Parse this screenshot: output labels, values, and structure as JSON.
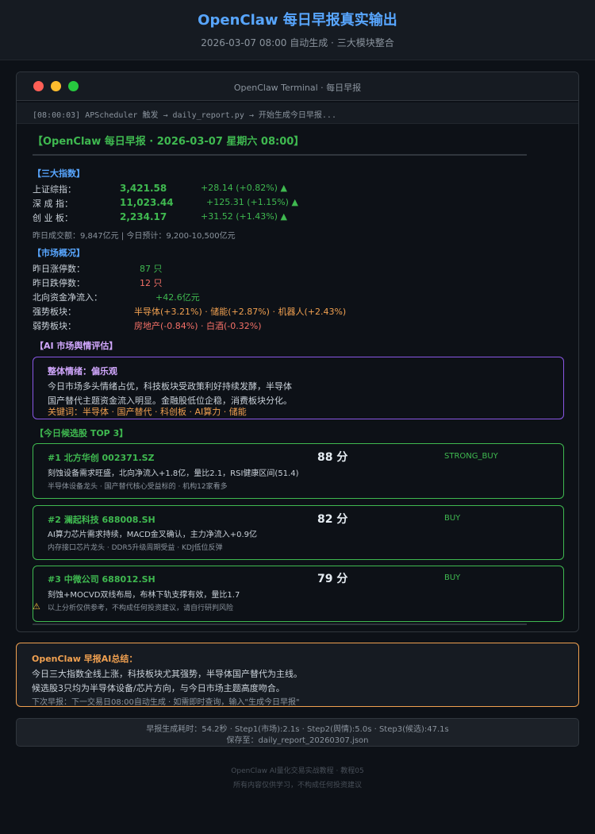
{
  "header": {
    "title": "OpenClaw 每日早报真实输出",
    "subtitle": "2026-03-07 08:00 自动生成 · 三大模块整合"
  },
  "terminal": {
    "window_title": "OpenClaw Terminal · 每日早报",
    "command_line": "[08:00:03] APScheduler 触发 → daily_report.py → 开始生成今日早报...",
    "report_title": "【OpenClaw 每日早报 · 2026-03-07 星期六 08:00】"
  },
  "indices": {
    "section_title": "【三大指数】",
    "rows": [
      {
        "label": "上证综指：",
        "value": "3,421.58",
        "change": "+28.14 (+0.82%) ▲"
      },
      {
        "label": "深 成 指：",
        "value": "11,023.44",
        "change": "+125.31 (+1.15%) ▲"
      },
      {
        "label": "创 业 板：",
        "value": "2,234.17",
        "change": "+31.52 (+1.43%) ▲"
      }
    ],
    "turnover": "昨日成交额：9,847亿元 | 今日预计：9,200-10,500亿元"
  },
  "market": {
    "section_title": "【市场概况】",
    "limit_up_label": "昨日涨停数：",
    "limit_up_value": "87 只",
    "limit_down_label": "昨日跌停数：",
    "limit_down_value": "12 只",
    "northbound_label": "北向资金净流入：",
    "northbound_value": "+42.6亿元",
    "strong_label": "强势板块：",
    "strong_value": "半导体(+3.21%) · 储能(+2.87%) · 机器人(+2.43%)",
    "weak_label": "弱势板块：",
    "weak_value": "房地产(-0.84%) · 白酒(-0.32%)"
  },
  "sentiment": {
    "section_title": "【AI 市场舆情评估】",
    "overall": "整体情绪：偏乐观",
    "line1": "今日市场多头情绪占优，科技板块受政策利好持续发酵，半导体",
    "line2": "国产替代主题资金流入明显。金融股低位企稳，消费板块分化。",
    "keywords": "关键词：半导体 · 国产替代 · 科创板 · AI算力 · 储能"
  },
  "picks": {
    "section_title": "【今日候选股 TOP 3】",
    "items": [
      {
        "head": "#1 北方华创 002371.SZ",
        "score": "88 分",
        "signal": "STRONG_BUY",
        "desc": "刻蚀设备需求旺盛，北向净流入+1.8亿，量比2.1，RSI健康区间(51.4)",
        "tags": "半导体设备龙头 · 国产替代核心受益标的 · 机构12家看多"
      },
      {
        "head": "#2 澜起科技 688008.SH",
        "score": "82 分",
        "signal": "BUY",
        "desc": "AI算力芯片需求持续，MACD金叉确认，主力净流入+0.9亿",
        "tags": "内存接口芯片龙头 · DDR5升级周期受益 · KDJ低位反弹"
      },
      {
        "head": "#3 中微公司 688012.SH",
        "score": "79 分",
        "signal": "BUY",
        "desc": "刻蚀+MOCVD双线布局，布林下轨支撑有效，量比1.7",
        "tags": "以上分析仅供参考，不构成任何投资建议，请自行研判风险"
      }
    ]
  },
  "summary": {
    "title": "OpenClaw 早报AI总结：",
    "line1": "今日三大指数全线上涨，科技板块尤其强势，半导体国产替代为主线。",
    "line2": "候选股3只均为半导体设备/芯片方向，与今日市场主题高度吻合。",
    "next": "下次早报：下一交易日08:00自动生成 · 如需即时查询，输入\"生成今日早报\""
  },
  "stats": {
    "line1": "早报生成耗时：54.2秒 · Step1(市场):2.1s · Step2(舆情):5.0s · Step3(候选):47.1s",
    "line2": "保存至：daily_report_20260307.json"
  },
  "footer": {
    "line1": "OpenClaw AI量化交易实战教程 · 教程05",
    "line2": "所有内容仅供学习，不构成任何投资建议"
  },
  "colors": {
    "accent_blue": "#58a6ff",
    "up_green": "#3fb950",
    "down_red": "#f47067",
    "warn_orange": "#f0a050",
    "sentiment_purple": "#8957e5"
  }
}
